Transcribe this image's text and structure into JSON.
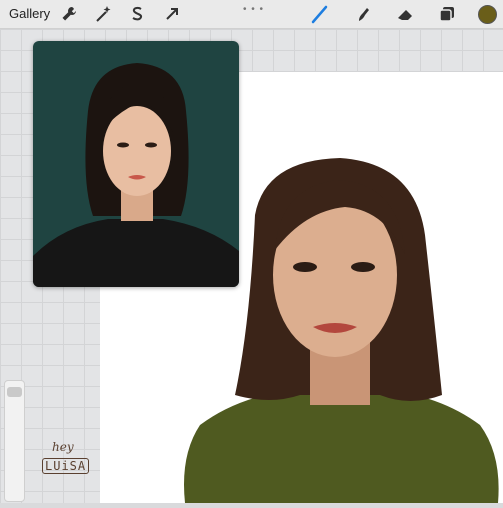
{
  "toolbar": {
    "gallery_label": "Gallery",
    "left_tools": [
      "wrench-icon",
      "magic-wand-icon",
      "selection-s-icon",
      "arrow-transform-icon"
    ],
    "right_tools": [
      "brush-icon",
      "smudge-icon",
      "eraser-icon",
      "layers-icon"
    ],
    "active_tool": "brush-icon",
    "active_color": "#6a5e19"
  },
  "signature": {
    "line1": "hey",
    "line2": "LUiSA"
  },
  "colors": {
    "reference_bg": "#1f4441",
    "sweater": "#4f5a20",
    "hair": "#3b2418"
  }
}
